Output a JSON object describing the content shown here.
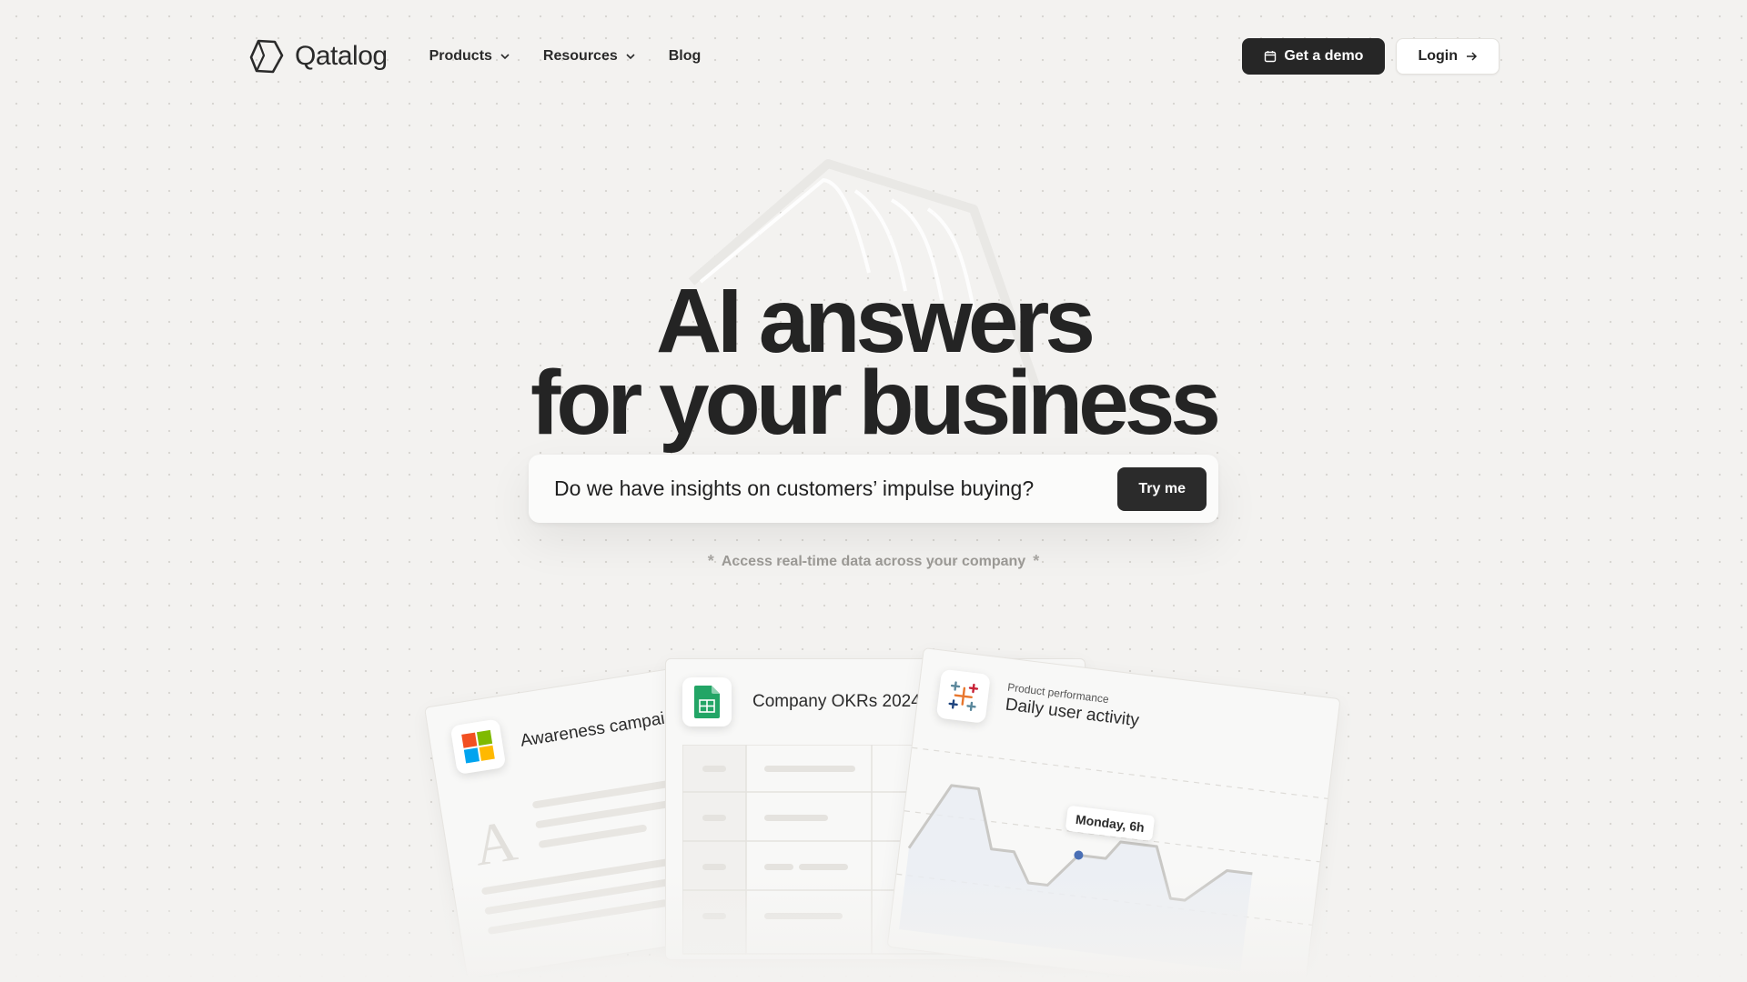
{
  "brand": {
    "name": "Qatalog"
  },
  "nav": {
    "items": [
      {
        "label": "Products",
        "has_dropdown": true
      },
      {
        "label": "Resources",
        "has_dropdown": true
      },
      {
        "label": "Blog",
        "has_dropdown": false
      }
    ]
  },
  "header": {
    "demo_label": "Get a demo",
    "login_label": "Login"
  },
  "hero": {
    "headline_line1": "AI answers",
    "headline_line2": "for your business",
    "search_text": "Do we have insights on customers’ impulse buying?",
    "try_label": "Try me",
    "tagline": "Access real-time data across your company"
  },
  "cards": {
    "left": {
      "title": "Awareness campaign",
      "icon": "microsoft-icon"
    },
    "middle": {
      "title": "Company OKRs 2024",
      "icon": "google-sheets-icon"
    },
    "right": {
      "subtitle": "Product performance",
      "title": "Daily user activity",
      "icon": "tableau-icon",
      "tooltip": "Monday, 6h"
    }
  },
  "colors": {
    "background": "#f3f2f0",
    "primary_dark": "#262626",
    "sheets_green": "#23a566",
    "chart_point": "#4a6fb5"
  }
}
